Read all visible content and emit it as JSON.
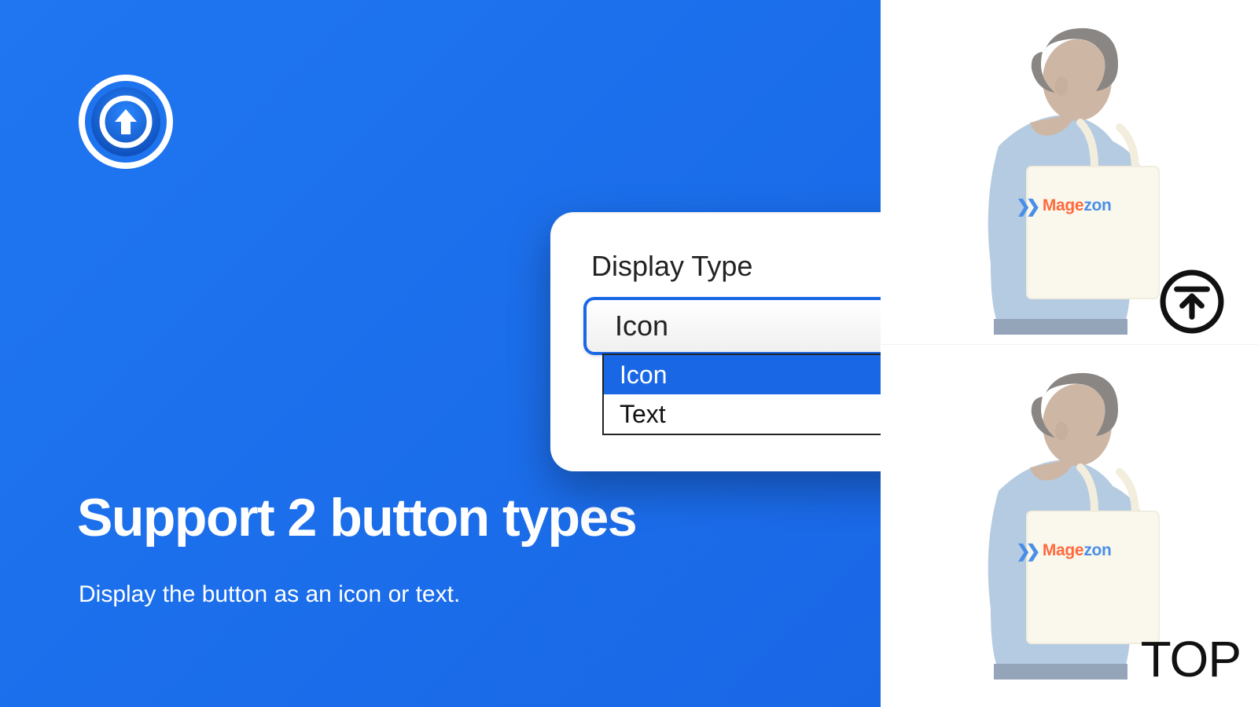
{
  "hero": {
    "headline": "Support 2 button types",
    "subline": "Display the button as an icon or text."
  },
  "dropdown": {
    "label": "Display Type",
    "value": "Icon",
    "options": [
      "Icon",
      "Text"
    ]
  },
  "preview": {
    "brand_prefix": "Mage",
    "brand_suffix": "zon",
    "text_button_label": "TOP"
  }
}
